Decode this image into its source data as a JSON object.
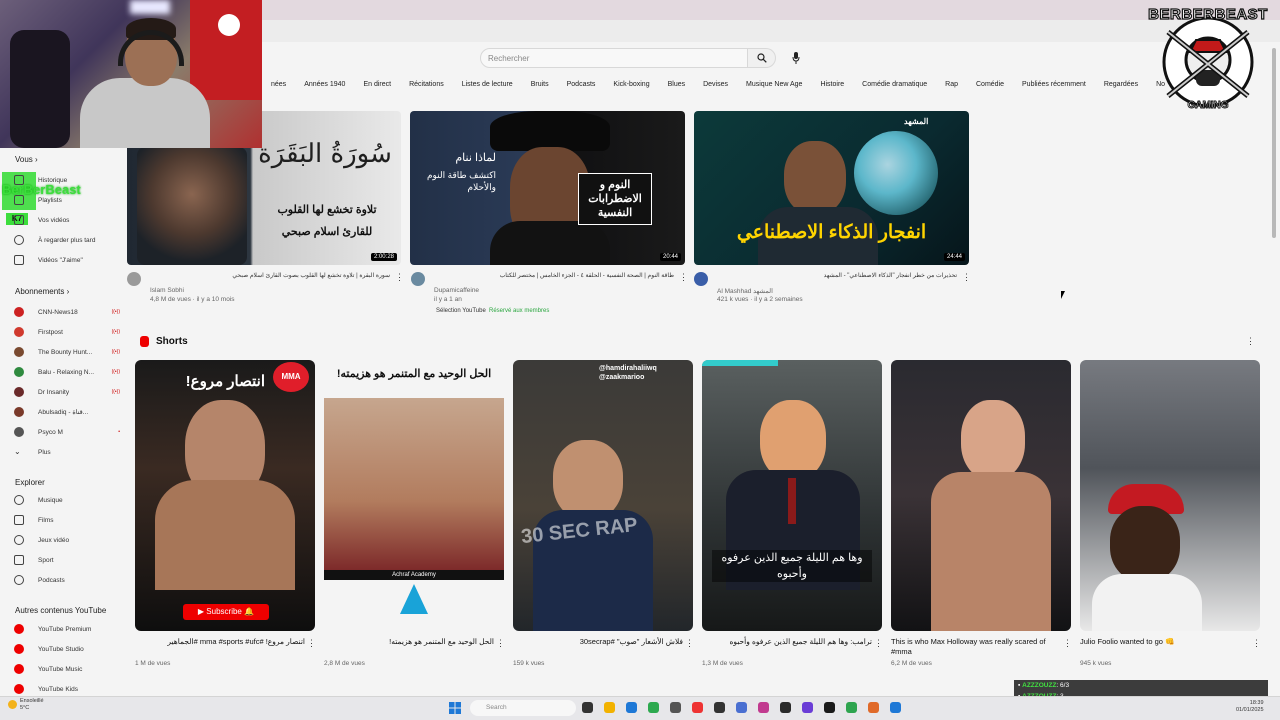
{
  "search": {
    "placeholder": "Rechercher"
  },
  "chips": [
    "nées",
    "Années 1940",
    "En direct",
    "Récitations",
    "Listes de lecture",
    "Bruits",
    "Podcasts",
    "Kick-boxing",
    "Blues",
    "Devises",
    "Musique New Age",
    "Histoire",
    "Comédie dramatique",
    "Rap",
    "Comédie",
    "Publiées récemment",
    "Regardées",
    "No"
  ],
  "logo": {
    "top_text": "BERBERBEAST",
    "bottom_text": "GAMING"
  },
  "sidebar": {
    "you_label": "Vous",
    "you_items": [
      {
        "label": "Historique"
      },
      {
        "label": "Playlists"
      },
      {
        "label": "Vos vidéos"
      },
      {
        "label": "À regarder plus tard"
      },
      {
        "label": "Vidéos \"J'aime\""
      }
    ],
    "subs_label": "Abonnements",
    "subs": [
      {
        "label": "CNN-News18",
        "live": "((•))",
        "color": "#cc2222"
      },
      {
        "label": "Firstpost",
        "live": "((•))",
        "color": "#d03a2e"
      },
      {
        "label": "The Bounty Hunt...",
        "live": "((•))",
        "color": "#7a4a30"
      },
      {
        "label": "Balu - Relaxing N...",
        "live": "((•))",
        "color": "#2f8a3f"
      },
      {
        "label": "Dr Insanity",
        "live": "((•))",
        "color": "#6a2a2a"
      },
      {
        "label": "Abulsadiq - قناة...",
        "live": "",
        "color": "#7a3a2a"
      },
      {
        "label": "Psyco M",
        "live": "•",
        "color": "#555555"
      },
      {
        "label": "Plus",
        "live": "",
        "color": ""
      }
    ],
    "explore_label": "Explorer",
    "explore": [
      {
        "label": "Musique"
      },
      {
        "label": "Films"
      },
      {
        "label": "Jeux vidéo"
      },
      {
        "label": "Sport"
      },
      {
        "label": "Podcasts"
      }
    ],
    "more_label": "Autres contenus YouTube",
    "more": [
      {
        "label": "YouTube Premium"
      },
      {
        "label": "YouTube Studio"
      },
      {
        "label": "YouTube Music"
      },
      {
        "label": "YouTube Kids"
      }
    ],
    "overlay_name": "BerBerBeast",
    "overlay_badge": "K7"
  },
  "videos": [
    {
      "title": "سورة البقرة | تلاوة تخشع لها القلوب بصوت القارئ اسلام صبحي",
      "channel": "Islam Sobhi",
      "views": "4,8 M de vues · il y a 10 mois",
      "duration": "2:00:28",
      "thumb_title": "سُورَةُ البَقَرَة",
      "thumb_sub": "تلاوة تخشع لها القلوب",
      "thumb_sub2": "للقارئ اسلام صبحي"
    },
    {
      "title": "طاقة النوم | الصحة النفسية - الحلقة ٤ - الجزء الخامس | مختصر للكتاب",
      "channel": "Dupamicaffeine",
      "views": "il y a 1 an",
      "duration": "20:44",
      "thumb_title": "النوم و الاضطرابات النفسية",
      "thumb_sub": "لماذا ننام",
      "thumb_sub2": "اكتشف طاقة النوم والأحلام"
    },
    {
      "title": "تحذيرات من خطر انفجار \"الذكاء الاصطناعي\" - المشهد",
      "channel": "Al Mashhad المشهد",
      "views": "421 k vues · il y a 2 semaines",
      "duration": "24:44",
      "thumb_title": "انفجار الذكاء الاصطناعي",
      "thumb_sub": "المشهد",
      "thumb_sub2": ""
    }
  ],
  "selection_label": "Sélection YouTube",
  "members_label": "Réservé aux membres",
  "shorts": {
    "header": "Shorts",
    "items": [
      {
        "title": "اتنصار مروع! #mma #sports #ufc #الجماهير",
        "views": "1 M de vues",
        "overlay": "انتصار مروع!",
        "badge": "MMA"
      },
      {
        "title": "الحل الوحيد مع المتنمر هو هزيمته!",
        "views": "2,8 M de vues",
        "overlay": "الحل الوحيد مع المتنمر هو هزيمته!",
        "badge": "Achraf Academy"
      },
      {
        "title": "فلاش الأشعار \"صوب\" #30secrap",
        "views": "159 k vues",
        "overlay": "30 SEC RAP",
        "badge": "@hamdirahaliiwq @zaakmarioo"
      },
      {
        "title": "ترامب: وها هم الليلة جميع الذين عرفوه وأحبوه",
        "views": "1,3 M de vues",
        "overlay": "وها هم الليلة جميع الذين عرفوه وأحبوه",
        "badge": ""
      },
      {
        "title": "This is who Max Holloway was really scared of #mma",
        "views": "6,2 M de vues",
        "overlay": "",
        "badge": ""
      },
      {
        "title": "Julio Foolio wanted to go 👊",
        "views": "945 k vues",
        "overlay": "",
        "badge": ""
      }
    ]
  },
  "taskbar": {
    "search": "Search",
    "weather": "Ensoleillé\n5°C",
    "time": "18:39",
    "date": "01/01/2025"
  },
  "chat": [
    {
      "name": "AZZZOUZZ",
      "msg": ": 6/3"
    },
    {
      "name": "AZZZOUZZ",
      "msg": ": 3"
    }
  ]
}
